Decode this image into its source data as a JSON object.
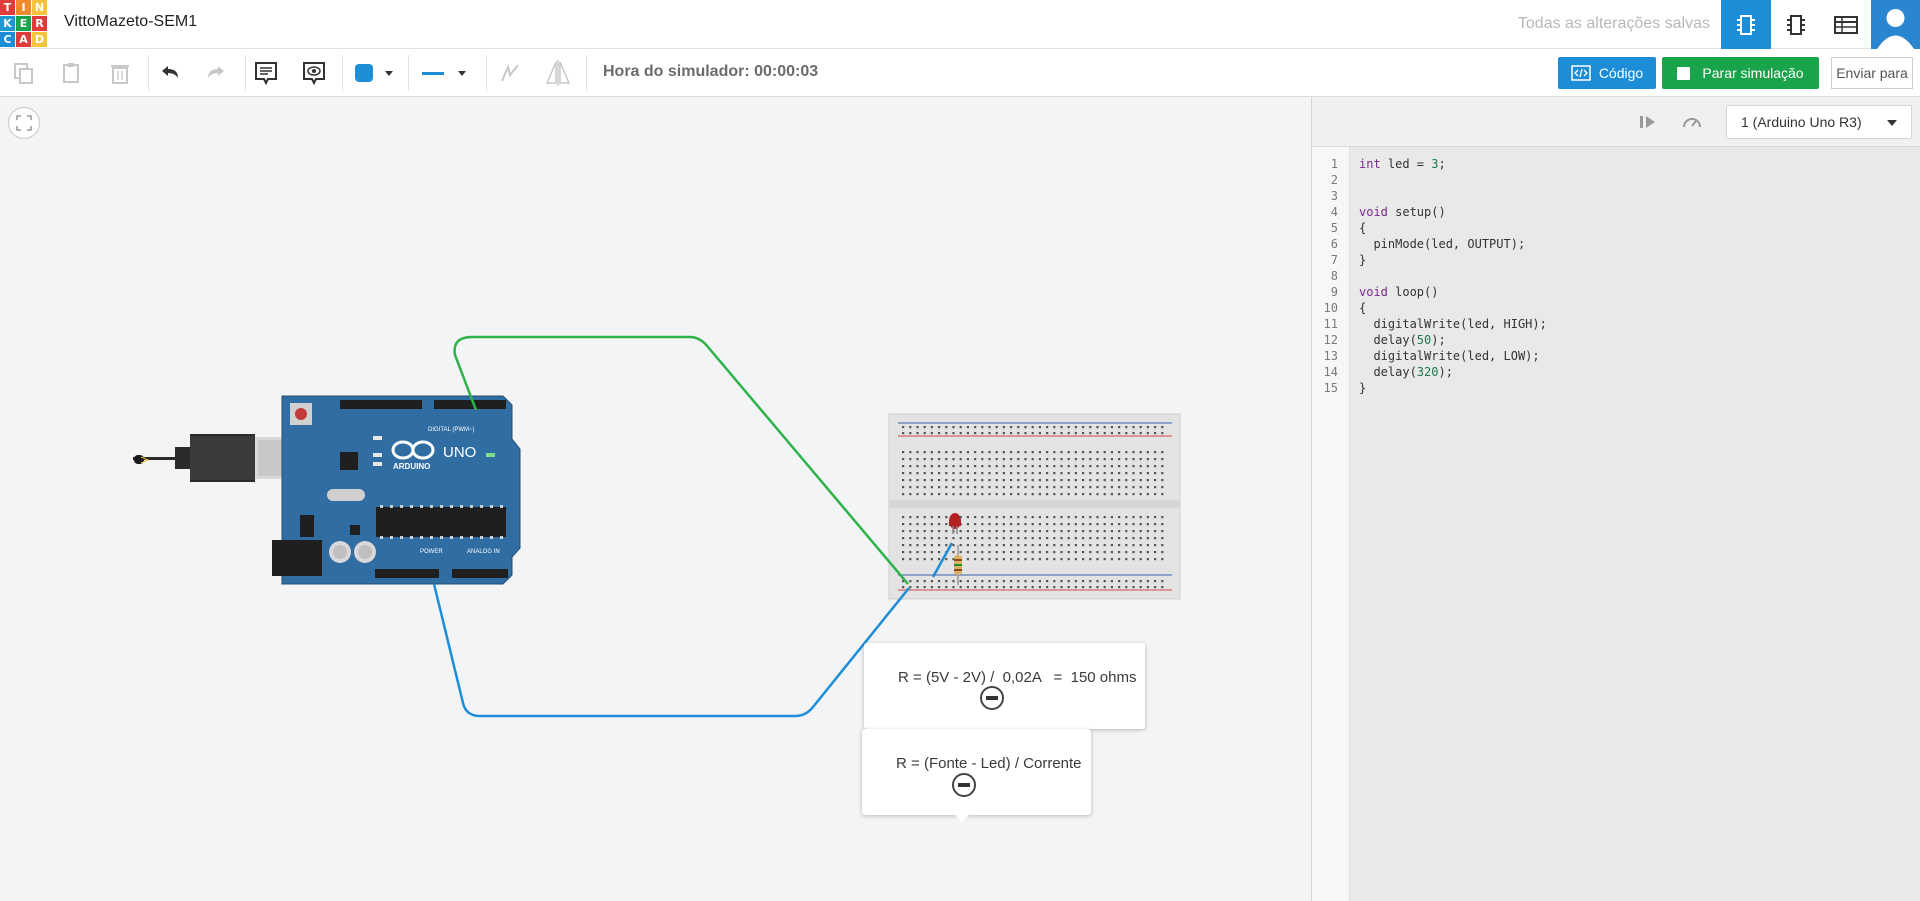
{
  "app": {
    "logo_letters": [
      "T",
      "I",
      "N",
      "K",
      "E",
      "R",
      "C",
      "A",
      "D"
    ],
    "logo_colors": [
      "#e03b3b",
      "#f08a2d",
      "#f6c341",
      "#1f97d4",
      "#19a34a",
      "#e03b3b",
      "#1c8dd6",
      "#e03b3b",
      "#f6c341"
    ],
    "project_title": "VittoMazeto-SEM1",
    "save_status": "Todas as alterações salvas"
  },
  "toolbar": {
    "sim_time": "Hora do simulador: 00:00:03",
    "code_button": "Código",
    "stop_button": "Parar simulação",
    "send_button": "Enviar para",
    "fill_color": "#1c8dd6"
  },
  "notes": [
    {
      "text": "R = (5V - 2V) /  0,02A   =  150 ohms"
    },
    {
      "text": "R = (Fonte - Led) / Corrente"
    }
  ],
  "arduino": {
    "brand": "ARDUINO",
    "model": "UNO",
    "digital_label": "DIGITAL (PWM~)",
    "power_label": "POWER",
    "analog_label": "ANALOG IN"
  },
  "code_panel": {
    "device": "1 (Arduino Uno R3)",
    "lines": [
      "int led = 3;",
      "",
      "",
      "void setup()",
      "{",
      "  pinMode(led, OUTPUT);",
      "}",
      "",
      "void loop()",
      "{",
      "  digitalWrite(led, HIGH);",
      "  delay(50);",
      "  digitalWrite(led, LOW);",
      "  delay(320);",
      "}"
    ],
    "line_numbers": [
      "1",
      "2",
      "3",
      "4",
      "5",
      "6",
      "7",
      "8",
      "9",
      "10",
      "11",
      "12",
      "13",
      "14",
      "15"
    ]
  }
}
